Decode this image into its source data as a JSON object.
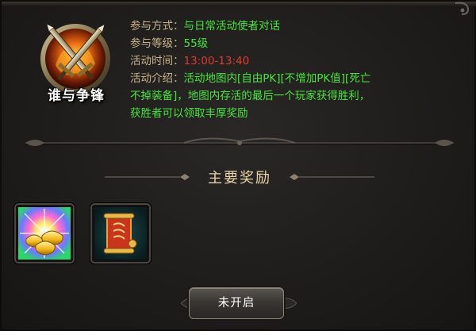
{
  "event": {
    "title": "谁与争锋"
  },
  "info": {
    "method_label": "参与方式：",
    "method_value": "与日常活动使者对话",
    "level_label": "参与等级：",
    "level_value": "55级",
    "time_label": "活动时间：",
    "time_value": "13:00-13:40",
    "intro_label": "活动介绍：",
    "intro_line1": "活动地图内[自由PK][不增加PK值][死亡",
    "intro_line2": "不掉装备]，地图内存活的最后一个玩家获得胜利，",
    "intro_line3": "获胜者可以领取丰厚奖励"
  },
  "rewards": {
    "heading": "主要奖励",
    "items": [
      {
        "icon": "gold-ingot-chest-icon"
      },
      {
        "icon": "red-scroll-icon"
      }
    ]
  },
  "action": {
    "button_label": "未开启"
  },
  "colors": {
    "label": "#c9b28a",
    "green_text": "#4be23f",
    "red_text": "#e23b2e",
    "heading": "#e9d4a8"
  }
}
